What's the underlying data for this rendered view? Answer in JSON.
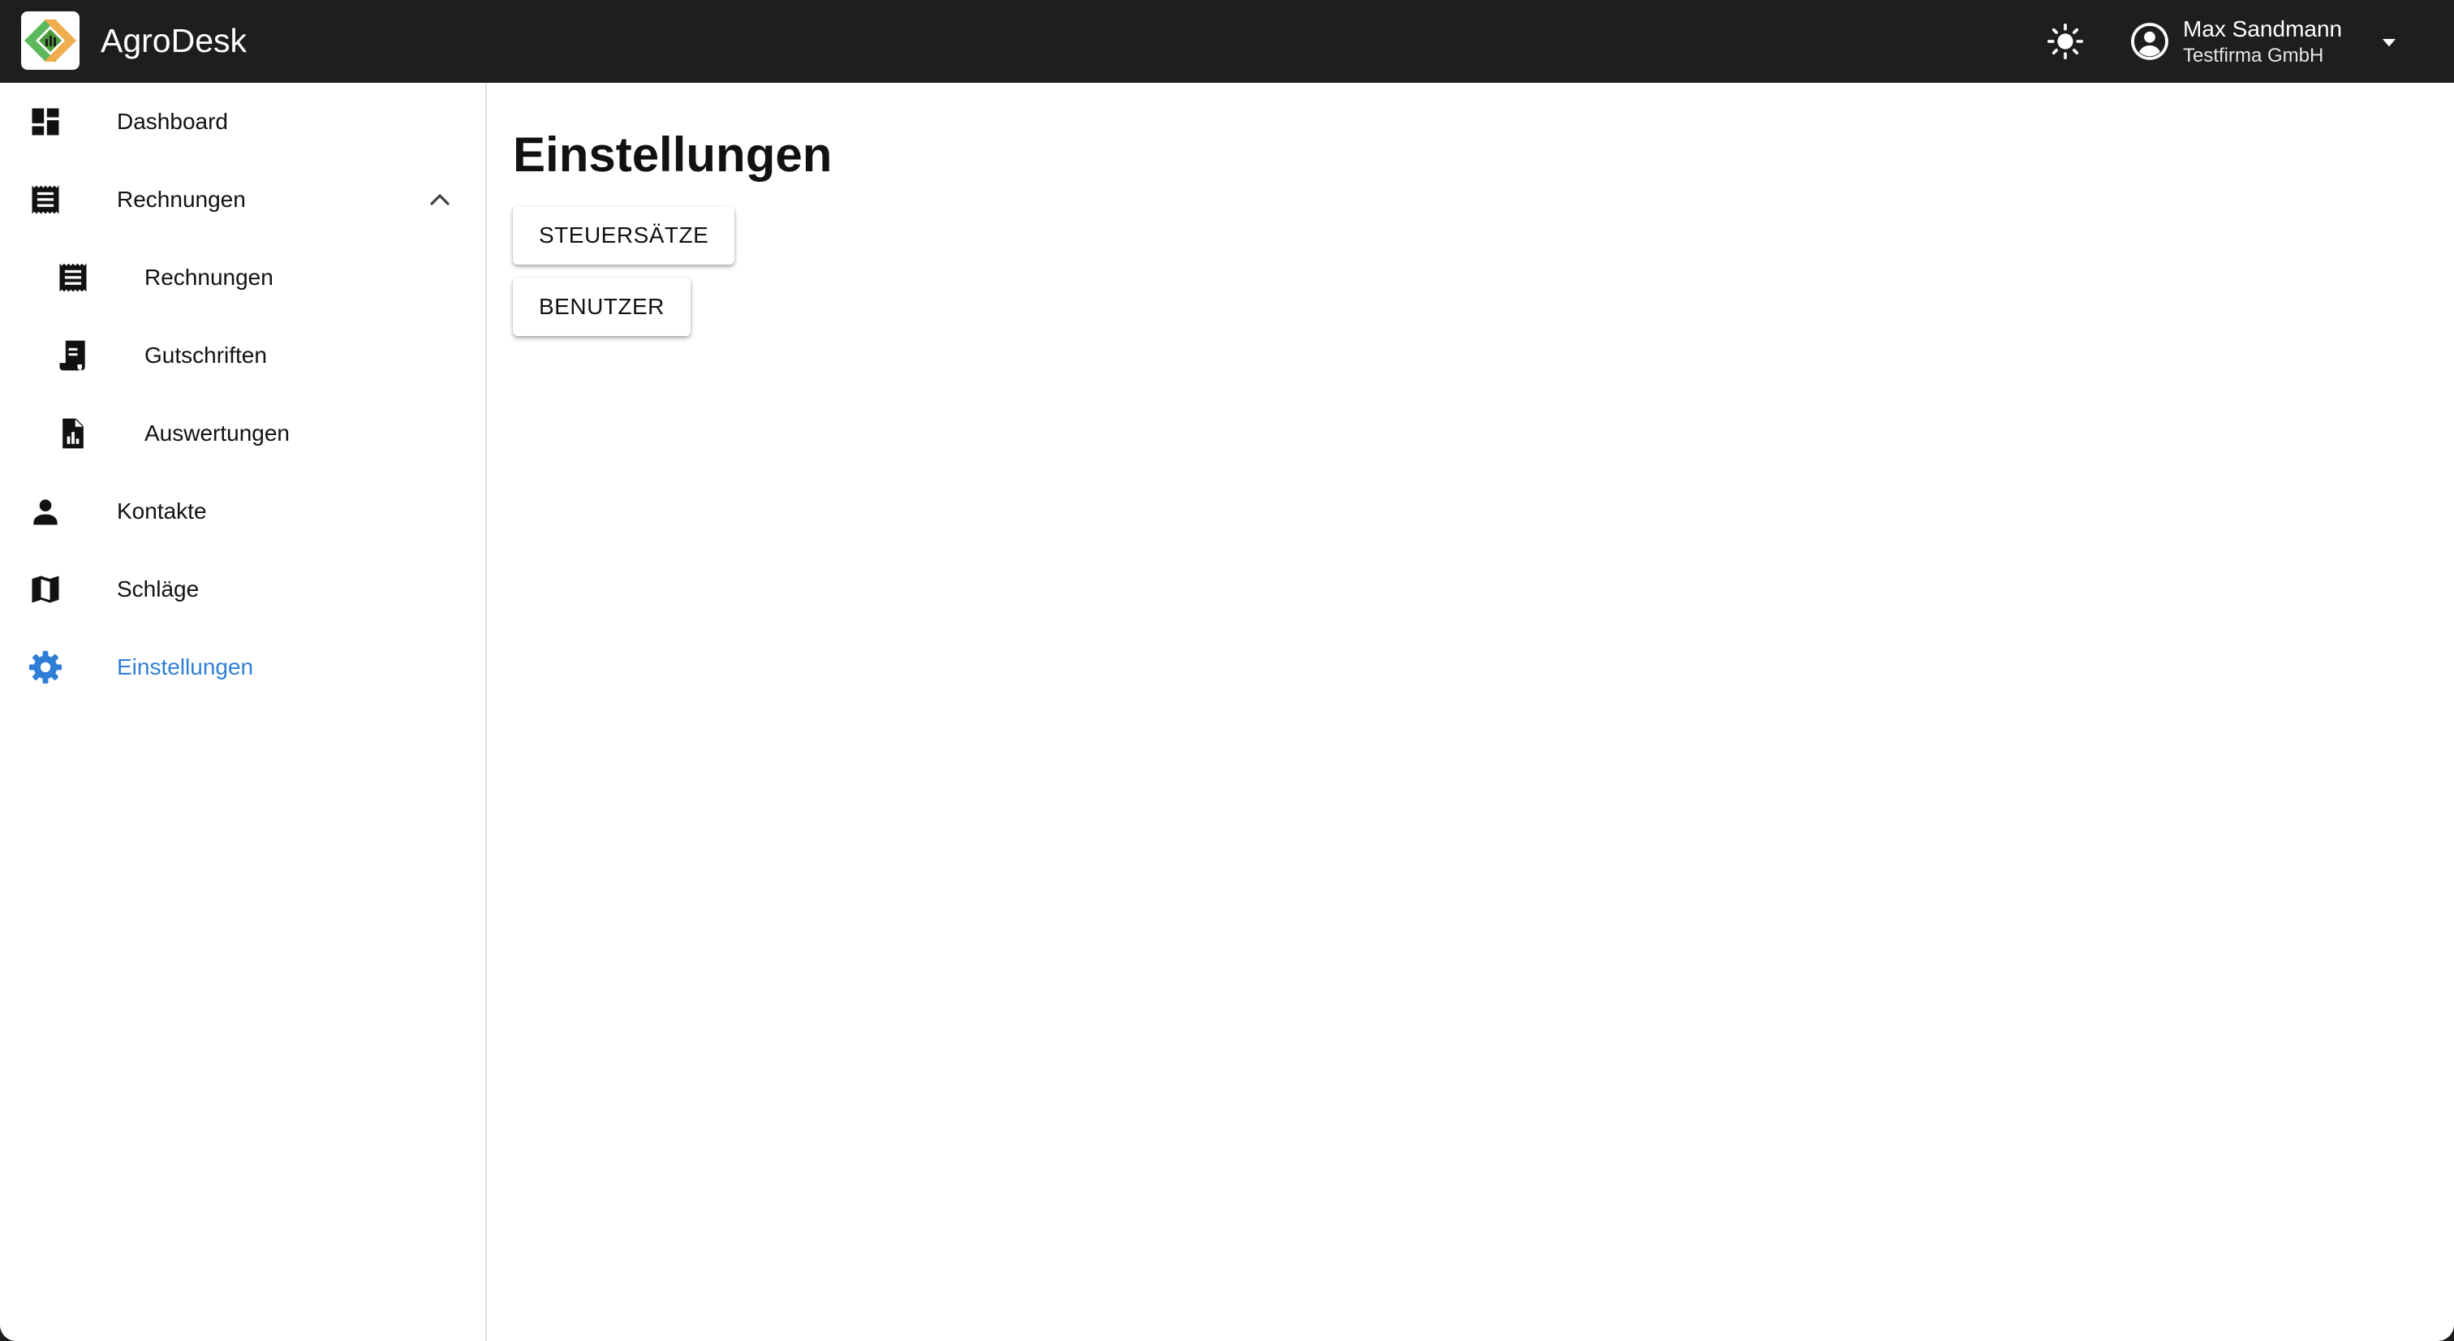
{
  "header": {
    "app_title": "AgroDesk",
    "user_name": "Max Sandmann",
    "user_company": "Testfirma GmbH",
    "icons": [
      "brightness-icon",
      "account-circle-icon",
      "caret-down-icon"
    ]
  },
  "sidebar": {
    "items": [
      {
        "label": "Dashboard",
        "icon": "dashboard-icon"
      },
      {
        "label": "Rechnungen",
        "icon": "receipt-icon",
        "expanded": true
      },
      {
        "label": "Rechnungen",
        "icon": "receipt-icon"
      },
      {
        "label": "Gutschriften",
        "icon": "credit-note-icon"
      },
      {
        "label": "Auswertungen",
        "icon": "report-icon"
      },
      {
        "label": "Kontakte",
        "icon": "person-icon"
      },
      {
        "label": "Schläge",
        "icon": "map-icon"
      },
      {
        "label": "Einstellungen",
        "icon": "gear-icon",
        "active": true
      }
    ]
  },
  "main": {
    "title": "Einstellungen",
    "buttons": [
      {
        "label": "STEUERSÄTZE"
      },
      {
        "label": "BENUTZER"
      }
    ]
  },
  "colors": {
    "topbar": "#1e1e1e",
    "accent": "#2f7fd6",
    "logo_green": "#5cb85c",
    "logo_orange": "#f0ad4e"
  }
}
